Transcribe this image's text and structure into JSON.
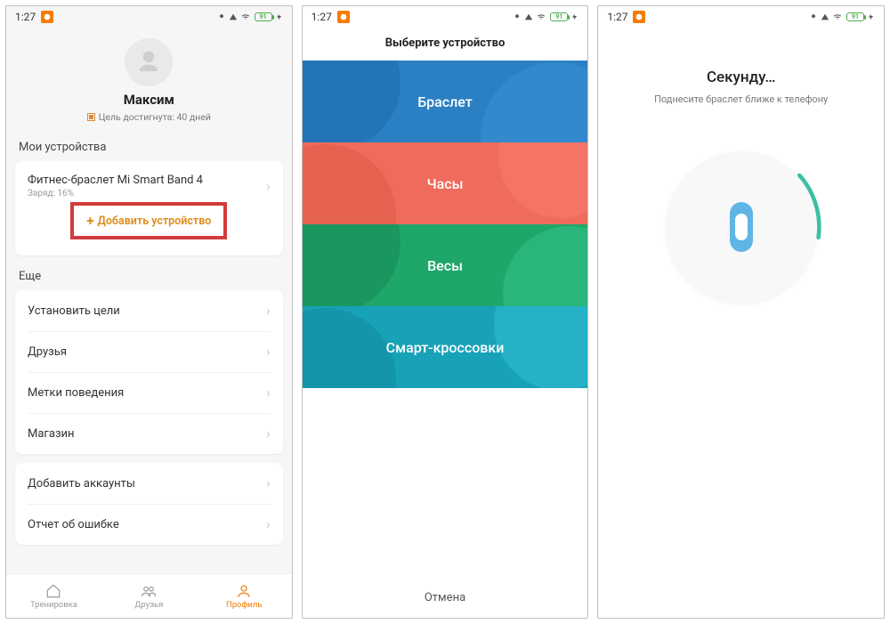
{
  "statusbar": {
    "time": "1:27",
    "battery": "91"
  },
  "screen1": {
    "username": "Максим",
    "goal_text": "Цель достигнута: 40 дней",
    "section_devices": "Мои устройства",
    "device_name": "Фитнес-браслет Mi Smart Band 4",
    "device_sub": "Заряд: 16%",
    "add_device": "Добавить устройство",
    "section_more": "Еще",
    "rows": {
      "goals": "Установить цели",
      "friends": "Друзья",
      "behavior": "Метки поведения",
      "store": "Магазин",
      "add_accounts": "Добавить аккаунты",
      "bug_report": "Отчет об ошибке"
    },
    "tabs": {
      "workout": "Тренировка",
      "friends": "Друзья",
      "profile": "Профиль"
    }
  },
  "screen2": {
    "title": "Выберите устройство",
    "tiles": {
      "bracelet": "Браслет",
      "watch": "Часы",
      "scale": "Весы",
      "sneakers": "Смарт-кроссовки"
    },
    "cancel": "Отмена"
  },
  "screen3": {
    "title": "Секунду…",
    "subtitle": "Поднесите браслет ближе к телефону"
  }
}
